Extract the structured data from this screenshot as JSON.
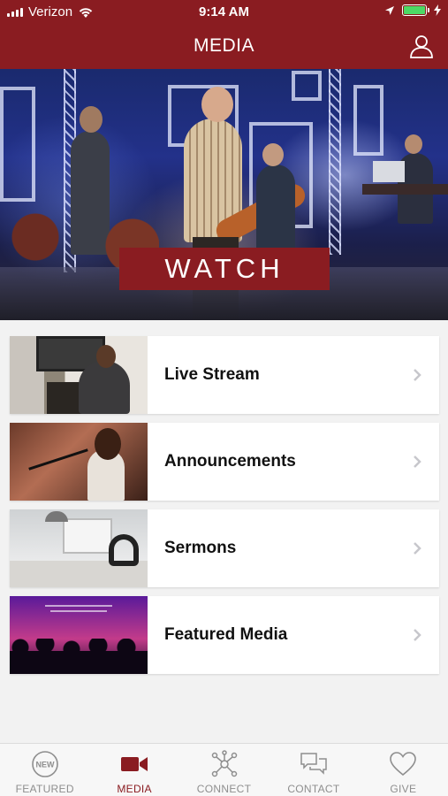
{
  "status_bar": {
    "carrier": "Verizon",
    "time": "9:14 AM",
    "battery_level": 1.0
  },
  "header": {
    "title": "MEDIA"
  },
  "hero": {
    "button_label": "WATCH"
  },
  "media_list": [
    {
      "label": "Live Stream",
      "thumb": "live-stream-thumbnail"
    },
    {
      "label": "Announcements",
      "thumb": "announcements-thumbnail"
    },
    {
      "label": "Sermons",
      "thumb": "sermons-thumbnail"
    },
    {
      "label": "Featured Media",
      "thumb": "featured-media-thumbnail"
    }
  ],
  "tabs": [
    {
      "label": "FEATURED",
      "icon": "new-badge-icon",
      "active": false
    },
    {
      "label": "MEDIA",
      "icon": "video-camera-icon",
      "active": true
    },
    {
      "label": "CONNECT",
      "icon": "network-icon",
      "active": false
    },
    {
      "label": "CONTACT",
      "icon": "chat-bubbles-icon",
      "active": false
    },
    {
      "label": "GIVE",
      "icon": "heart-icon",
      "active": false
    }
  ],
  "new_badge_text": "NEW",
  "colors": {
    "brand": "#8a1c21",
    "inactive_tab": "#8e8e8e",
    "battery": "#4cd964"
  }
}
